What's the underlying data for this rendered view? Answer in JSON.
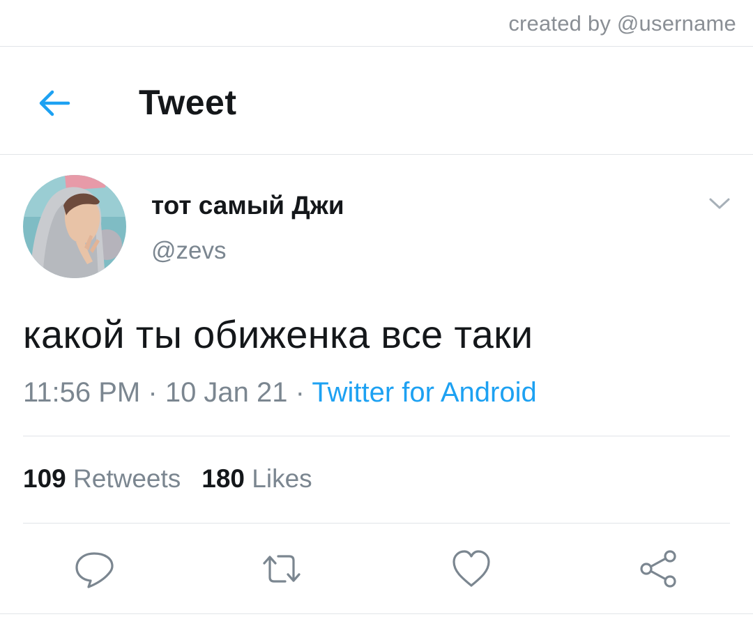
{
  "credit": "created by @username",
  "header": {
    "title": "Tweet",
    "back_icon": "arrow-left-icon",
    "accent": "#1da1f2"
  },
  "author": {
    "display_name": "тот самый Джи",
    "handle": "@zevs",
    "avatar": "profile-photo",
    "menu_icon": "chevron-down-icon"
  },
  "tweet": {
    "text": "какой ты обиженка все таки",
    "time": "11:56 PM",
    "date": "10 Jan 21",
    "separator": "·",
    "source": "Twitter for Android"
  },
  "stats": {
    "retweets_count": "109",
    "retweets_label": "Retweets",
    "likes_count": "180",
    "likes_label": "Likes"
  },
  "actions": [
    {
      "icon": "reply-icon"
    },
    {
      "icon": "retweet-icon"
    },
    {
      "icon": "heart-icon"
    },
    {
      "icon": "share-icon"
    }
  ],
  "colors": {
    "text": "#14171a",
    "secondary": "#7b8690",
    "link": "#1da1f2",
    "divider": "#e1e4e8"
  }
}
